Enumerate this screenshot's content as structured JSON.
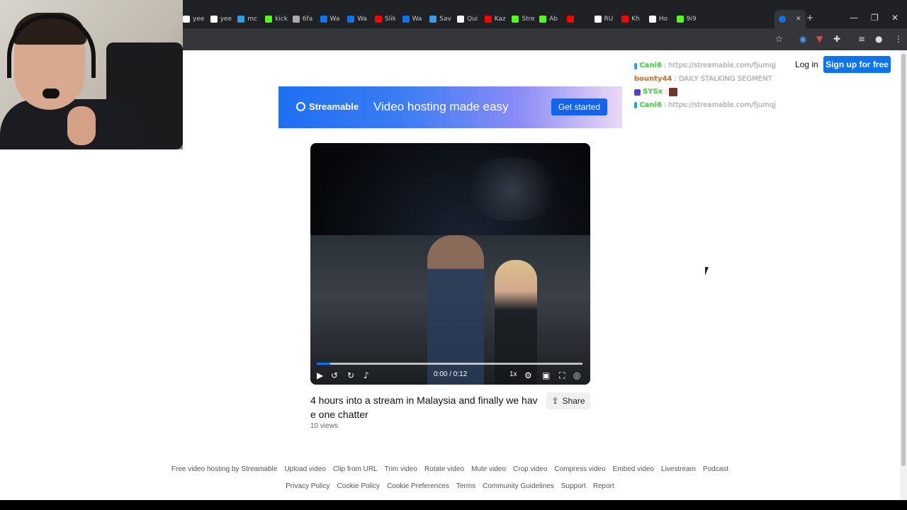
{
  "browser": {
    "tabs": [
      {
        "label": "yee",
        "favicon_color": "#ffffff"
      },
      {
        "label": "yee",
        "favicon_color": "#ffffff"
      },
      {
        "label": "mc",
        "favicon_color": "#2aa0e0"
      },
      {
        "label": "kick",
        "favicon_color": "#53fc18"
      },
      {
        "label": "6fa",
        "favicon_color": "#aaaaaa"
      },
      {
        "label": "Wa",
        "favicon_color": "#0f73ee"
      },
      {
        "label": "Wa",
        "favicon_color": "#0f73ee"
      },
      {
        "label": "Slik",
        "favicon_color": "#ff0000"
      },
      {
        "label": "Wa",
        "favicon_color": "#0f73ee"
      },
      {
        "label": "Sav",
        "favicon_color": "#3d9ae8"
      },
      {
        "label": "Qui",
        "favicon_color": "#ffffff"
      },
      {
        "label": "Kaz",
        "favicon_color": "#ff0000"
      },
      {
        "label": "Stre",
        "favicon_color": "#53fc18"
      },
      {
        "label": "Ab",
        "favicon_color": "#53fc18"
      },
      {
        "label": "",
        "favicon_color": "#ff0000"
      },
      {
        "label": "RU",
        "favicon_color": "#ffffff"
      },
      {
        "label": "Kh",
        "favicon_color": "#ff0000"
      },
      {
        "label": "Ho",
        "favicon_color": "#ffffff"
      },
      {
        "label": "9i9",
        "favicon_color": "#53fc18"
      }
    ],
    "new_tab_glyph": "+",
    "close_glyph": "✕",
    "window_controls": [
      "—",
      "❐",
      "✕"
    ]
  },
  "header": {
    "login_label": "Log in",
    "signup_label": "Sign up for free"
  },
  "chat": {
    "messages": [
      {
        "user": "Cani6",
        "user_color": "#5ad35a",
        "text": "https://streamable.com/fjumqj",
        "badge_color": "#2aa0e0"
      },
      {
        "user": "bounty44",
        "user_color": "#c8843a",
        "text": "DAILY STALKING SEGMENT",
        "badge_color": ""
      },
      {
        "user": "SYSx",
        "user_color": "#5ad35a",
        "text": "",
        "badge_color": "#5b3ec8",
        "emote": true
      },
      {
        "user": "Cani6",
        "user_color": "#5ad35a",
        "text": "https://streamable.com/fjumqj",
        "badge_color": "#2aa0e0"
      }
    ]
  },
  "banner": {
    "brand": "Streamable",
    "headline": "Video hosting made easy",
    "cta_label": "Get started"
  },
  "video": {
    "time_display": "0:00 / 0:12",
    "playback_rate": "1x",
    "progress": 0.05,
    "title": "4 hours into a stream in Malaysia and finally we have one chatter",
    "views": "10 views",
    "share_label": "Share"
  },
  "footer": {
    "row1": [
      "Free video hosting by Streamable",
      "Upload video",
      "Clip from URL",
      "Trim video",
      "Rotate video",
      "Mute video",
      "Crop video",
      "Compress video",
      "Embed video",
      "Livestream",
      "Podcast"
    ],
    "row2": [
      "Privacy Policy",
      "Cookie Policy",
      "Cookie Preferences",
      "Terms",
      "Community Guidelines",
      "Support",
      "Report"
    ]
  },
  "colors": {
    "accent": "#0f73ee",
    "chrome_dark": "#202124",
    "chrome_bar": "#35363a"
  }
}
